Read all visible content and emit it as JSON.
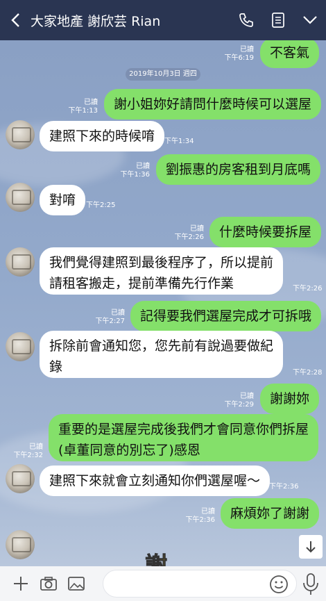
{
  "header": {
    "title": "大家地產 謝欣芸 Rian",
    "icons": [
      "back-arrow-icon",
      "phone-icon",
      "note-icon",
      "chevron-down-icon"
    ]
  },
  "date_separator": "2019年10月3日 週四",
  "messages": [
    {
      "dir": "out",
      "text": "不客氣",
      "read": "已讀",
      "time": "下午6:19"
    },
    {
      "dir": "out",
      "text": "謝小姐妳好請問什麼時候可以選屋",
      "read": "已讀",
      "time": "下午1:13"
    },
    {
      "dir": "in",
      "text": "建照下來的時候唷",
      "time": "下午1:34"
    },
    {
      "dir": "out",
      "text": "劉振惠的房客租到月底嗎",
      "read": "已讀",
      "time": "下午1:36"
    },
    {
      "dir": "in",
      "text": "對唷",
      "time": "下午2:25"
    },
    {
      "dir": "out",
      "text": "什麼時候要拆屋",
      "read": "已讀",
      "time": "下午2:26"
    },
    {
      "dir": "in",
      "lines": [
        "我們覺得建照到最後程序了，所以提前",
        "請租客搬走，提前準備先行作業"
      ],
      "time": "下午2:26"
    },
    {
      "dir": "out",
      "text": "記得要我們選屋完成才可拆哦",
      "read": "已讀",
      "time": "下午2:27"
    },
    {
      "dir": "in",
      "lines": [
        "拆除前會通知您，您先前有說過要做紀",
        "錄"
      ],
      "time": "下午2:28"
    },
    {
      "dir": "out",
      "text": "謝謝妳",
      "read": "已讀",
      "time": "下午2:29"
    },
    {
      "dir": "out",
      "lines": [
        "重要的是選屋完成後我們才會同意你們拆屋",
        "(卓董同意的別忘了)感恩"
      ],
      "read": "已讀",
      "time": "下午2:32"
    },
    {
      "dir": "in",
      "text": "建照下來就會立刻通知你們選屋喔～",
      "time": "下午2:36"
    },
    {
      "dir": "out",
      "text": "麻煩妳了謝謝",
      "read": "已讀",
      "time": "下午2:36"
    }
  ],
  "sticker_text": "謝",
  "input": {
    "placeholder": ""
  },
  "colors": {
    "header": "#2a3552",
    "out_bubble": "#84e06a",
    "in_bubble": "#ffffff",
    "chat_bg": "#8ea2c2"
  }
}
